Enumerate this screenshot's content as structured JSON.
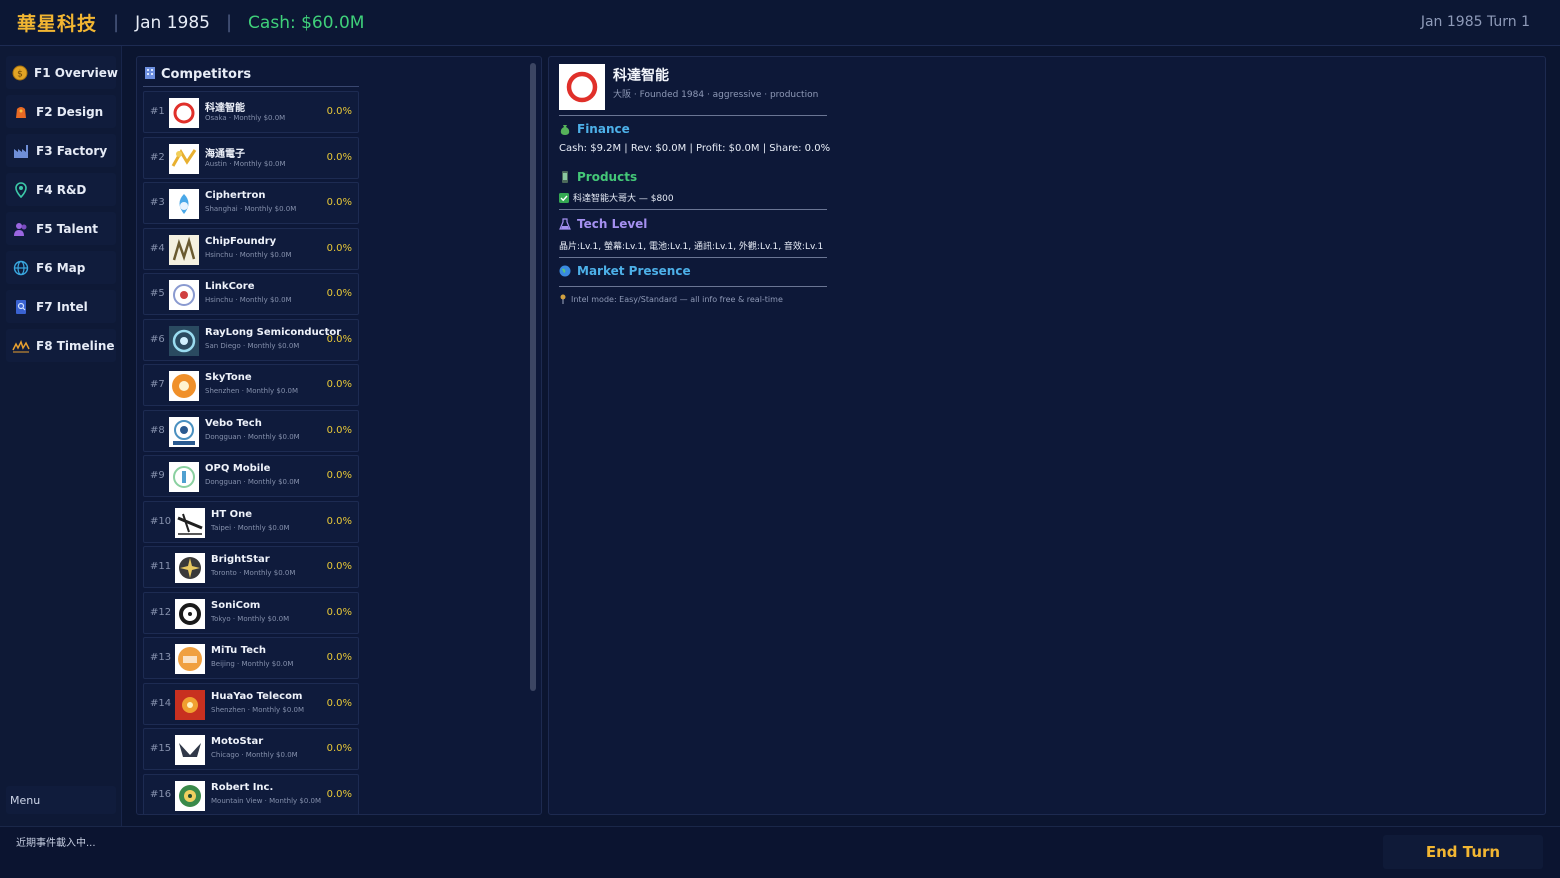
{
  "topbar": {
    "company": "華星科技",
    "date": "Jan 1985",
    "cash": "Cash: $60.0M",
    "turn": "Jan 1985 Turn 1"
  },
  "sidebar": {
    "items": [
      {
        "label": "F1 Overview",
        "icon": "coin-icon"
      },
      {
        "label": "F2 Design",
        "icon": "palette-icon"
      },
      {
        "label": "F3 Factory",
        "icon": "factory-icon"
      },
      {
        "label": "F4 R&D",
        "icon": "pin-icon"
      },
      {
        "label": "F5 Talent",
        "icon": "people-icon"
      },
      {
        "label": "F6 Map",
        "icon": "globe-icon"
      },
      {
        "label": "F7 Intel",
        "icon": "document-icon"
      },
      {
        "label": "F8 Timeline",
        "icon": "timeline-icon"
      }
    ],
    "menu": "Menu"
  },
  "competitors": {
    "title": "Competitors",
    "rows": [
      {
        "rank": "#1",
        "name": "科達智能",
        "sub": "Osaka · Monthly $0.0M",
        "share": "0.0%"
      },
      {
        "rank": "#2",
        "name": "海通電子",
        "sub": "Austin · Monthly $0.0M",
        "share": "0.0%"
      },
      {
        "rank": "#3",
        "name": "Ciphertron",
        "sub": "Shanghai · Monthly $0.0M",
        "share": "0.0%"
      },
      {
        "rank": "#4",
        "name": "ChipFoundry",
        "sub": "Hsinchu · Monthly $0.0M",
        "share": "0.0%"
      },
      {
        "rank": "#5",
        "name": "LinkCore",
        "sub": "Hsinchu · Monthly $0.0M",
        "share": "0.0%"
      },
      {
        "rank": "#6",
        "name": "RayLong Semiconductor",
        "sub": "San Diego · Monthly $0.0M",
        "share": "0.0%"
      },
      {
        "rank": "#7",
        "name": "SkyTone",
        "sub": "Shenzhen · Monthly $0.0M",
        "share": "0.0%"
      },
      {
        "rank": "#8",
        "name": "Vebo Tech",
        "sub": "Dongguan · Monthly $0.0M",
        "share": "0.0%"
      },
      {
        "rank": "#9",
        "name": "OPQ Mobile",
        "sub": "Dongguan · Monthly $0.0M",
        "share": "0.0%"
      },
      {
        "rank": "#10",
        "name": "HT One",
        "sub": "Taipei · Monthly $0.0M",
        "share": "0.0%"
      },
      {
        "rank": "#11",
        "name": "BrightStar",
        "sub": "Toronto · Monthly $0.0M",
        "share": "0.0%"
      },
      {
        "rank": "#12",
        "name": "SoniCom",
        "sub": "Tokyo · Monthly $0.0M",
        "share": "0.0%"
      },
      {
        "rank": "#13",
        "name": "MiTu Tech",
        "sub": "Beijing · Monthly $0.0M",
        "share": "0.0%"
      },
      {
        "rank": "#14",
        "name": "HuaYao Telecom",
        "sub": "Shenzhen · Monthly $0.0M",
        "share": "0.0%"
      },
      {
        "rank": "#15",
        "name": "MotoStar",
        "sub": "Chicago · Monthly $0.0M",
        "share": "0.0%"
      },
      {
        "rank": "#16",
        "name": "Robert Inc.",
        "sub": "Mountain View · Monthly $0.0M",
        "share": "0.0%"
      }
    ]
  },
  "detail": {
    "name": "科達智能",
    "meta": "大阪 · Founded 1984 · aggressive · production",
    "finance_title": "Finance",
    "finance_text": "Cash: $9.2M  |  Rev: $0.0M  |  Profit: $0.0M  |  Share: 0.0%",
    "products_title": "Products",
    "product_item": "科達智能大哥大 — $800",
    "tech_title": "Tech Level",
    "tech_text": "晶片:Lv.1, 螢幕:Lv.1, 電池:Lv.1, 通訊:Lv.1, 外觀:Lv.1, 音效:Lv.1",
    "market_title": "Market Presence",
    "intel_note": "Intel mode: Easy/Standard — all info free & real-time"
  },
  "bottombar": {
    "news": "近期事件載入中...",
    "end_turn": "End Turn"
  },
  "colors": {
    "accent_gold": "#f2b632",
    "cash_green": "#3fd07a",
    "share_yellow": "#e8c838",
    "section_blue": "#4db0e8",
    "section_green": "#44c878",
    "section_purple": "#a490f0"
  }
}
